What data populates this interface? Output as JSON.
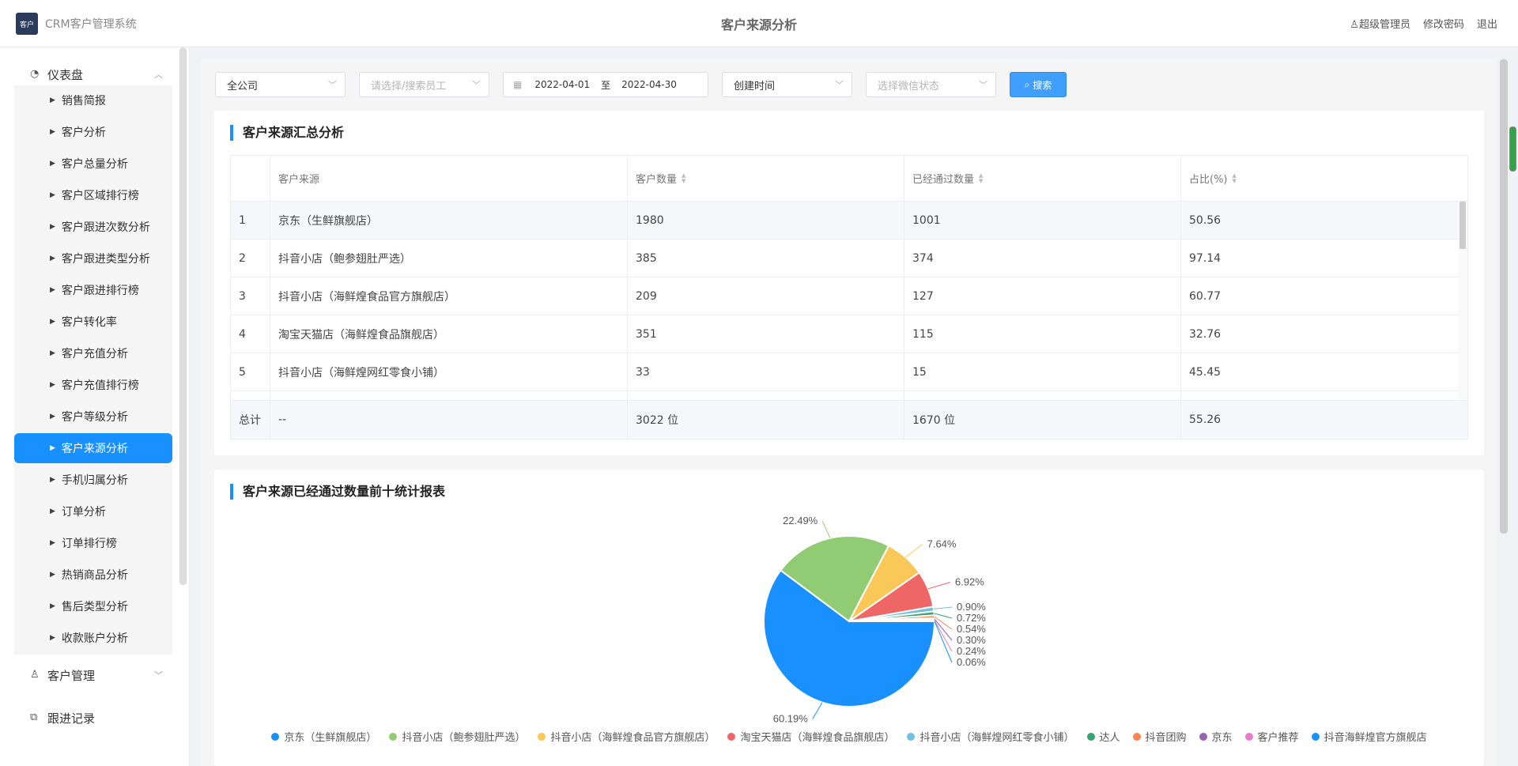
{
  "header": {
    "logo_text": "客户",
    "app_name": "CRM客户管理系统",
    "title": "客户来源分析",
    "user": "超级管理员",
    "change_password": "修改密码",
    "logout": "退出"
  },
  "sidebar": {
    "dashboard": "仪表盘",
    "items": [
      {
        "label": "销售简报"
      },
      {
        "label": "客户分析"
      },
      {
        "label": "客户总量分析"
      },
      {
        "label": "客户区域排行榜"
      },
      {
        "label": "客户跟进次数分析"
      },
      {
        "label": "客户跟进类型分析"
      },
      {
        "label": "客户跟进排行榜"
      },
      {
        "label": "客户转化率"
      },
      {
        "label": "客户充值分析"
      },
      {
        "label": "客户充值排行榜"
      },
      {
        "label": "客户等级分析"
      },
      {
        "label": "客户来源分析",
        "active": true
      },
      {
        "label": "手机归属分析"
      },
      {
        "label": "订单分析"
      },
      {
        "label": "订单排行榜"
      },
      {
        "label": "热销商品分析"
      },
      {
        "label": "售后类型分析"
      },
      {
        "label": "收款账户分析"
      }
    ],
    "customer_mgmt": "客户管理",
    "follow_records": "跟进记录"
  },
  "filters": {
    "company": "全公司",
    "employee_placeholder": "请选择/搜索员工",
    "date_start": "2022-04-01",
    "date_sep": "至",
    "date_end": "2022-04-30",
    "time_type": "创建时间",
    "wechat_placeholder": "选择微信状态",
    "search_label": "搜索"
  },
  "summary": {
    "title": "客户来源汇总分析",
    "columns": [
      "",
      "客户来源",
      "客户数量",
      "已经通过数量",
      "占比(%)"
    ],
    "rows": [
      [
        "1",
        "京东（生鲜旗舰店）",
        "1980",
        "1001",
        "50.56"
      ],
      [
        "2",
        "抖音小店（鲍参翅肚严选）",
        "385",
        "374",
        "97.14"
      ],
      [
        "3",
        "抖音小店（海鲜煌食品官方旗舰店）",
        "209",
        "127",
        "60.77"
      ],
      [
        "4",
        "淘宝天猫店（海鲜煌食品旗舰店）",
        "351",
        "115",
        "32.76"
      ],
      [
        "5",
        "抖音小店（海鲜煌网红零食小铺）",
        "33",
        "15",
        "45.45"
      ]
    ],
    "total": [
      "总计",
      "--",
      "3022 位",
      "1670 位",
      "55.26"
    ]
  },
  "chart_panel_title": "客户来源已经通过数量前十统计报表",
  "chart_data": {
    "type": "pie",
    "categories": [
      "京东（生鲜旗舰店）",
      "抖音小店（鲍参翅肚严选）",
      "抖音小店（海鲜煌食品官方旗舰店）",
      "淘宝天猫店（海鲜煌食品旗舰店）",
      "抖音小店（海鲜煌网红零食小铺）",
      "达人",
      "抖音团购",
      "京东",
      "客户推荐",
      "抖音海鲜煌官方旗舰店"
    ],
    "values": [
      60.19,
      22.49,
      7.64,
      6.92,
      0.9,
      0.72,
      0.54,
      0.3,
      0.24,
      0.06
    ],
    "labels": [
      "60.19%",
      "22.49%",
      "7.64%",
      "6.92%",
      "0.90%",
      "0.72%",
      "0.54%",
      "0.30%",
      "0.24%",
      "0.06%"
    ],
    "colors": [
      "#1890ff",
      "#91cc75",
      "#fac858",
      "#ee6666",
      "#73c0de",
      "#3ba272",
      "#fc8452",
      "#9a60b4",
      "#ea7ccc",
      "#1890ff"
    ],
    "legend_position": "bottom"
  }
}
